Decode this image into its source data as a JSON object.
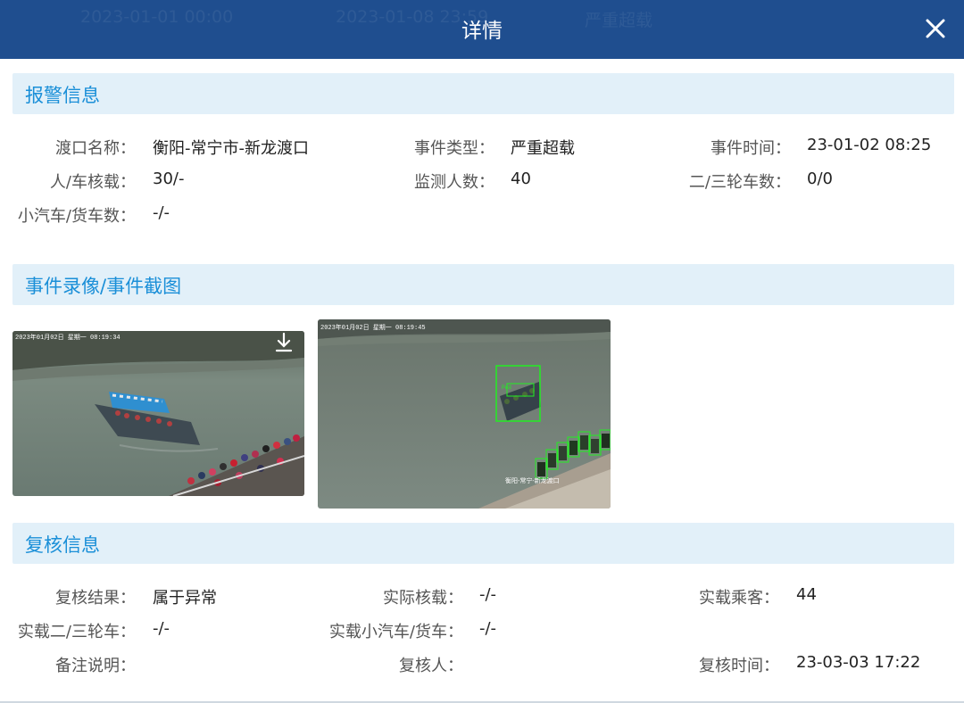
{
  "dialog": {
    "title": "详情",
    "close_label": "✕",
    "background_ghost": [
      "2023-01-01 00:00",
      "2023-01-08 23:59",
      "严重超载"
    ]
  },
  "alarm": {
    "section_title": "报警信息",
    "fields": [
      {
        "label": "渡口名称：",
        "value": "衡阳-常宁市-新龙渡口"
      },
      {
        "label": "事件类型：",
        "value": "严重超载"
      },
      {
        "label": "事件时间：",
        "value": "23-01-02 08:25"
      },
      {
        "label": "人/车核载：",
        "value": "30/-"
      },
      {
        "label": "监测人数：",
        "value": "40"
      },
      {
        "label": "二/三轮车数：",
        "value": "0/0"
      },
      {
        "label": "小汽车/货车数：",
        "value": "-/-"
      }
    ]
  },
  "media": {
    "section_title": "事件录像/事件截图",
    "video_overlay": "2023年01月02日 星期一 08:19:34",
    "snapshot_overlay": "2023年01月02日 星期一 08:19:45",
    "snapshot_caption": "衡阳-常宁-新龙渡口",
    "detection_label": "Ped"
  },
  "review": {
    "section_title": "复核信息",
    "fields": [
      {
        "label": "复核结果：",
        "value": "属于异常"
      },
      {
        "label": "实际核载：",
        "value": "-/-"
      },
      {
        "label": "实载乘客：",
        "value": "44"
      },
      {
        "label": "实载二/三轮车：",
        "value": "-/-"
      },
      {
        "label": "实载小汽车/货车：",
        "value": "-/-"
      },
      {
        "label": "备注说明：",
        "value": ""
      },
      {
        "label": "复核人：",
        "value": ""
      },
      {
        "label": "复核时间：",
        "value": "23-03-03 17:22"
      }
    ]
  },
  "colors": {
    "header_bg": "#1f4e8f",
    "section_bg": "#e2f0f9",
    "section_title": "#1a8fd8",
    "detection_box": "#22ee22"
  }
}
